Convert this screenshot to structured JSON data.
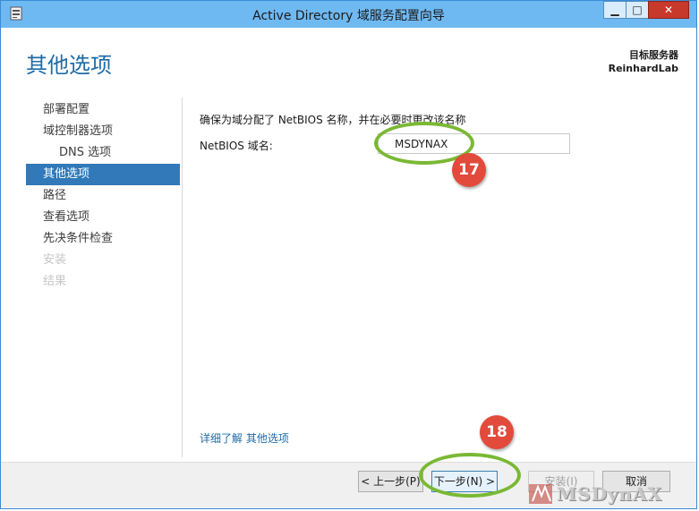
{
  "window": {
    "title": "Active Directory 域服务配置向导",
    "buttons": {
      "minimize": "▁",
      "maximize": "□",
      "close": "✕"
    }
  },
  "header": {
    "page_title": "其他选项",
    "target_server_label": "目标服务器",
    "target_server_name": "ReinhardLab"
  },
  "sidebar": {
    "items": [
      {
        "label": "部署配置",
        "state": "normal"
      },
      {
        "label": "域控制器选项",
        "state": "normal"
      },
      {
        "label": "DNS 选项",
        "state": "sub"
      },
      {
        "label": "其他选项",
        "state": "active"
      },
      {
        "label": "路径",
        "state": "normal"
      },
      {
        "label": "查看选项",
        "state": "normal"
      },
      {
        "label": "先决条件检查",
        "state": "normal"
      },
      {
        "label": "安装",
        "state": "disabled"
      },
      {
        "label": "结果",
        "state": "disabled"
      }
    ]
  },
  "main": {
    "instruction": "确保为域分配了 NetBIOS 名称，并在必要时更改该名称",
    "netbios_label": "NetBIOS 域名:",
    "netbios_value": "MSDYNAX",
    "learn_more": "详细了解 其他选项"
  },
  "footer": {
    "prev": "< 上一步(P)",
    "next": "下一步(N) >",
    "install": "安装(I)",
    "cancel": "取消"
  },
  "annotations": {
    "badge_17": "17",
    "badge_18": "18",
    "ring_color": "#7ab834",
    "badge_color": "#e24a3b"
  },
  "watermark": {
    "text": "MSDynAX"
  },
  "colors": {
    "titlebar": "#6fb9f2",
    "accent": "#3179b8",
    "title_text": "#1e6ba8"
  }
}
